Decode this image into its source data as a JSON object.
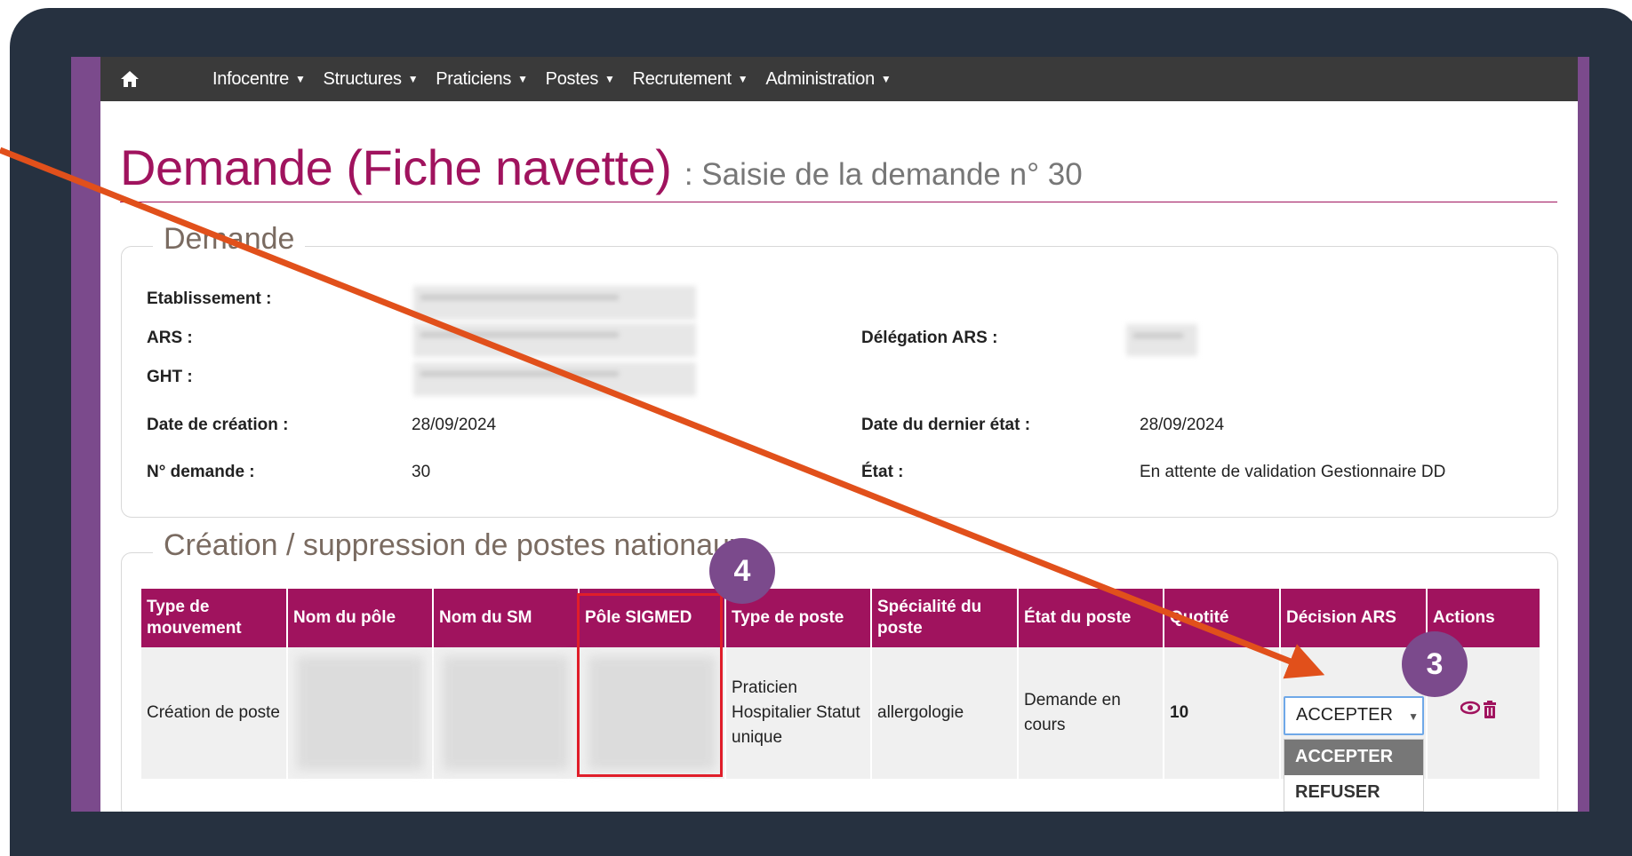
{
  "nav": {
    "items": [
      {
        "label": "Infocentre"
      },
      {
        "label": "Structures"
      },
      {
        "label": "Praticiens"
      },
      {
        "label": "Postes"
      },
      {
        "label": "Recrutement"
      },
      {
        "label": "Administration"
      }
    ]
  },
  "page": {
    "title": "Demande (Fiche navette)",
    "subtitle": ": Saisie de la demande n° 30"
  },
  "demande": {
    "legend": "Demande",
    "etablissement_label": "Etablissement :",
    "ars_label": "ARS :",
    "ght_label": "GHT :",
    "delegation_label": "Délégation ARS :",
    "date_creation_label": "Date de création :",
    "date_creation_value": "28/09/2024",
    "date_dernier_etat_label": "Date du dernier état :",
    "date_dernier_etat_value": "28/09/2024",
    "numero_label": "N° demande :",
    "numero_value": "30",
    "etat_label": "État :",
    "etat_value": "En attente de validation Gestionnaire DD"
  },
  "postes": {
    "legend": "Création / suppression de postes nationaux",
    "columns": [
      "Type de mouvement",
      "Nom du pôle",
      "Nom du SM",
      "Pôle SIGMED",
      "Type de poste",
      "Spécialité du poste",
      "État du poste",
      "Quotité",
      "Décision ARS",
      "Actions"
    ],
    "row": {
      "type_mouvement": "Création de poste",
      "type_poste": "Praticien Hospitalier Statut unique",
      "specialite": "allergologie",
      "etat": "Demande en cours",
      "quotite": "10"
    },
    "decision": {
      "selected": "ACCEPTER",
      "options": [
        "ACCEPTER",
        "REFUSER"
      ]
    }
  },
  "annotations": {
    "badge_3": "3",
    "badge_4": "4"
  },
  "colors": {
    "accent": "#a0135e",
    "frame": "#263140",
    "purple": "#7b4a8c",
    "arrow": "#e1501b",
    "highlight": "#e01e2a"
  }
}
